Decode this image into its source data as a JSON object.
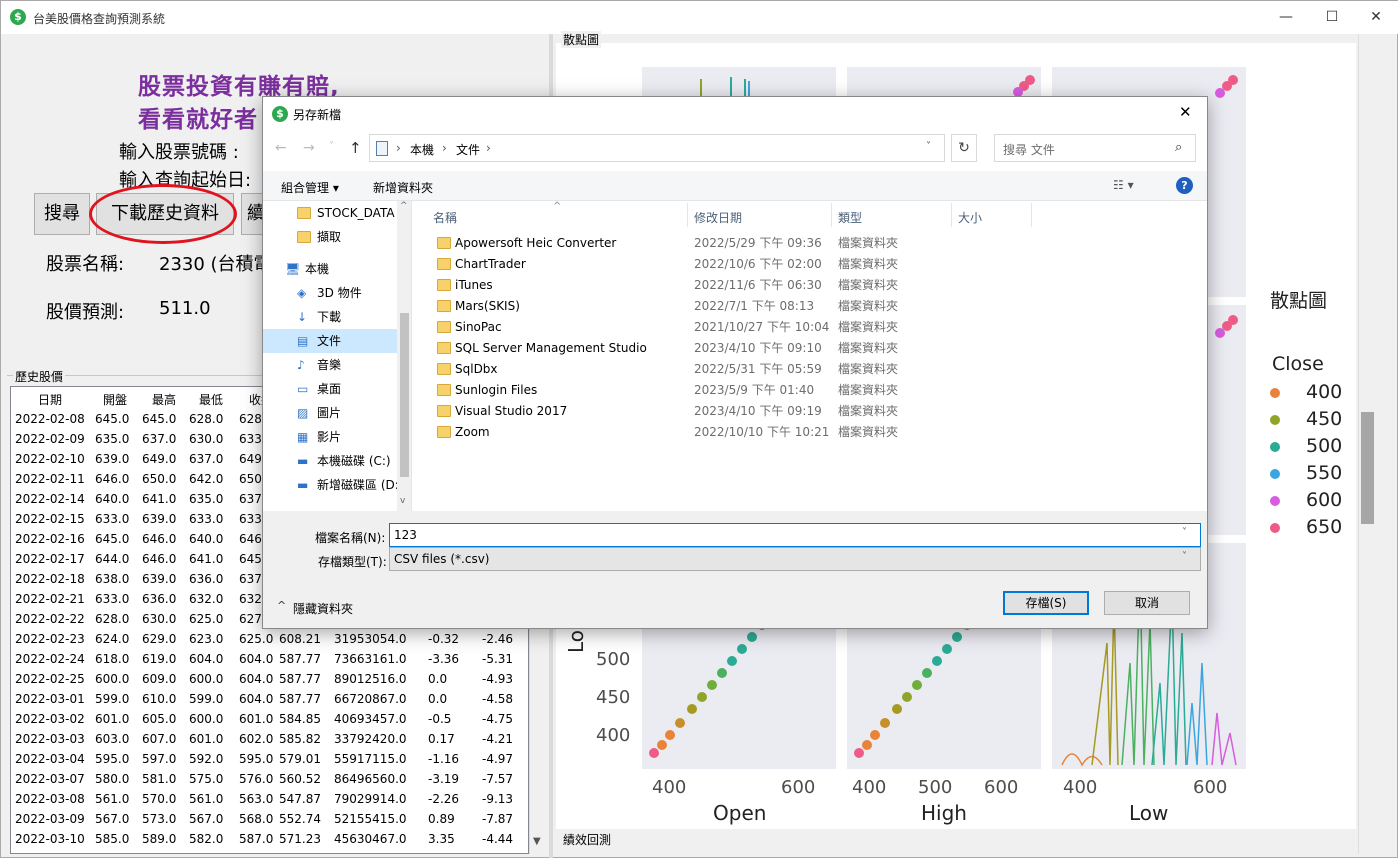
{
  "window": {
    "title": "台美股價格查詢預測系統",
    "minimize": "—",
    "maximize": "☐",
    "close": "✕"
  },
  "left": {
    "slogan_line1": "股票投資有賺有賠,",
    "slogan_line2": "看看就好者",
    "stock_code_label": "輸入股票號碼 :",
    "start_date_label": "輸入查詢起始日:",
    "search_button": "搜尋",
    "download_button": "下載歷史資料",
    "third_button": "續",
    "stock_name_label": "股票名稱:",
    "stock_name_value": "2330 (台積電",
    "forecast_label": "股價預測:",
    "forecast_value": "511.0",
    "history_group": "歷史股價",
    "columns": [
      "日期",
      "開盤",
      "最高",
      "最低",
      "收盤"
    ],
    "rows": [
      [
        "2022-02-08",
        "645.0",
        "645.0",
        "628.0",
        "628.",
        "",
        "",
        "",
        ""
      ],
      [
        "2022-02-09",
        "635.0",
        "637.0",
        "630.0",
        "633.",
        "",
        "",
        "",
        ""
      ],
      [
        "2022-02-10",
        "639.0",
        "649.0",
        "637.0",
        "649.",
        "",
        "",
        "",
        ""
      ],
      [
        "2022-02-11",
        "646.0",
        "650.0",
        "642.0",
        "650.",
        "",
        "",
        "",
        ""
      ],
      [
        "2022-02-14",
        "640.0",
        "641.0",
        "635.0",
        "637.",
        "",
        "",
        "",
        ""
      ],
      [
        "2022-02-15",
        "633.0",
        "639.0",
        "633.0",
        "633.",
        "",
        "",
        "",
        ""
      ],
      [
        "2022-02-16",
        "645.0",
        "646.0",
        "640.0",
        "646.",
        "",
        "",
        "",
        ""
      ],
      [
        "2022-02-17",
        "644.0",
        "646.0",
        "641.0",
        "645.",
        "",
        "",
        "",
        ""
      ],
      [
        "2022-02-18",
        "638.0",
        "639.0",
        "636.0",
        "637.",
        "",
        "",
        "",
        ""
      ],
      [
        "2022-02-21",
        "633.0",
        "636.0",
        "632.0",
        "632.",
        "",
        "",
        "",
        ""
      ],
      [
        "2022-02-22",
        "628.0",
        "630.0",
        "625.0",
        "627.",
        "",
        "",
        "",
        ""
      ],
      [
        "2022-02-23",
        "624.0",
        "629.0",
        "623.0",
        "625.0",
        "608.21",
        "31953054.0",
        "-0.32",
        "-2.46"
      ],
      [
        "2022-02-24",
        "618.0",
        "619.0",
        "604.0",
        "604.0",
        "587.77",
        "73663161.0",
        "-3.36",
        "-5.31"
      ],
      [
        "2022-02-25",
        "600.0",
        "609.0",
        "600.0",
        "604.0",
        "587.77",
        "89012516.0",
        "0.0",
        "-4.93"
      ],
      [
        "2022-03-01",
        "599.0",
        "610.0",
        "599.0",
        "604.0",
        "587.77",
        "66720867.0",
        "0.0",
        "-4.58"
      ],
      [
        "2022-03-02",
        "601.0",
        "605.0",
        "600.0",
        "601.0",
        "584.85",
        "40693457.0",
        "-0.5",
        "-4.75"
      ],
      [
        "2022-03-03",
        "603.0",
        "607.0",
        "601.0",
        "602.0",
        "585.82",
        "33792420.0",
        "0.17",
        "-4.21"
      ],
      [
        "2022-03-04",
        "595.0",
        "597.0",
        "592.0",
        "595.0",
        "579.01",
        "55917115.0",
        "-1.16",
        "-4.97"
      ],
      [
        "2022-03-07",
        "580.0",
        "581.0",
        "575.0",
        "576.0",
        "560.52",
        "86496560.0",
        "-3.19",
        "-7.57"
      ],
      [
        "2022-03-08",
        "561.0",
        "570.0",
        "561.0",
        "563.0",
        "547.87",
        "79029914.0",
        "-2.26",
        "-9.13"
      ],
      [
        "2022-03-09",
        "567.0",
        "573.0",
        "567.0",
        "568.0",
        "552.74",
        "52155415.0",
        "0.89",
        "-7.87"
      ],
      [
        "2022-03-10",
        "585.0",
        "589.0",
        "582.0",
        "587.0",
        "571.23",
        "45630467.0",
        "3.35",
        "-4.44"
      ]
    ]
  },
  "right": {
    "scatter_group": "散點圖",
    "perf_group": "績效回測",
    "plot_title": "散點圖",
    "legend_title": "Close",
    "legend": [
      {
        "label": "400",
        "color": "#e8833a"
      },
      {
        "label": "450",
        "color": "#8ea52a"
      },
      {
        "label": "500",
        "color": "#2bab96"
      },
      {
        "label": "550",
        "color": "#3aa6dd"
      },
      {
        "label": "600",
        "color": "#d85ce0"
      },
      {
        "label": "650",
        "color": "#ef5b87"
      }
    ],
    "y_axis_title": "Low",
    "y_ticks": [
      "500",
      "450",
      "400"
    ],
    "x_titles": [
      "Open",
      "High",
      "Low"
    ],
    "x_ticks_1": [
      "400",
      "600"
    ],
    "x_ticks_2": [
      "400",
      "500",
      "600"
    ],
    "x_ticks_3": [
      "400",
      "600"
    ]
  },
  "dialog": {
    "title": "另存新檔",
    "close": "✕",
    "path": [
      "本機",
      "文件"
    ],
    "search_placeholder": "搜尋 文件",
    "organize": "組合管理 ▾",
    "new_folder": "新增資料夾",
    "nav": [
      "STOCK_DATA",
      "擷取",
      "本機",
      "3D 物件",
      "下載",
      "文件",
      "音樂",
      "桌面",
      "圖片",
      "影片",
      "本機磁碟 (C:)",
      "新增磁碟區 (D:"
    ],
    "col_name": "名稱",
    "col_date": "修改日期",
    "col_type": "類型",
    "col_size": "大小",
    "files": [
      {
        "name": "Apowersoft Heic Converter",
        "date": "2022/5/29 下午 09:36",
        "type": "檔案資料夾"
      },
      {
        "name": "ChartTrader",
        "date": "2022/10/6 下午 02:00",
        "type": "檔案資料夾"
      },
      {
        "name": "iTunes",
        "date": "2022/11/6 下午 06:30",
        "type": "檔案資料夾"
      },
      {
        "name": "Mars(SKIS)",
        "date": "2022/7/1 下午 08:13",
        "type": "檔案資料夾"
      },
      {
        "name": "SinoPac",
        "date": "2021/10/27 下午 10:04",
        "type": "檔案資料夾"
      },
      {
        "name": "SQL Server Management Studio",
        "date": "2023/4/10 下午 09:10",
        "type": "檔案資料夾"
      },
      {
        "name": "SqlDbx",
        "date": "2022/5/31 下午 05:59",
        "type": "檔案資料夾"
      },
      {
        "name": "Sunlogin Files",
        "date": "2023/5/9 下午 01:40",
        "type": "檔案資料夾"
      },
      {
        "name": "Visual Studio 2017",
        "date": "2023/4/10 下午 09:19",
        "type": "檔案資料夾"
      },
      {
        "name": "Zoom",
        "date": "2022/10/10 下午 10:21",
        "type": "檔案資料夾"
      }
    ],
    "filename_label": "檔案名稱(N):",
    "filename_value": "123",
    "filetype_label": "存檔類型(T):",
    "filetype_value": "CSV files (*.csv)",
    "hide_folders": "隱藏資料夾",
    "save": "存檔(S)",
    "cancel": "取消"
  }
}
